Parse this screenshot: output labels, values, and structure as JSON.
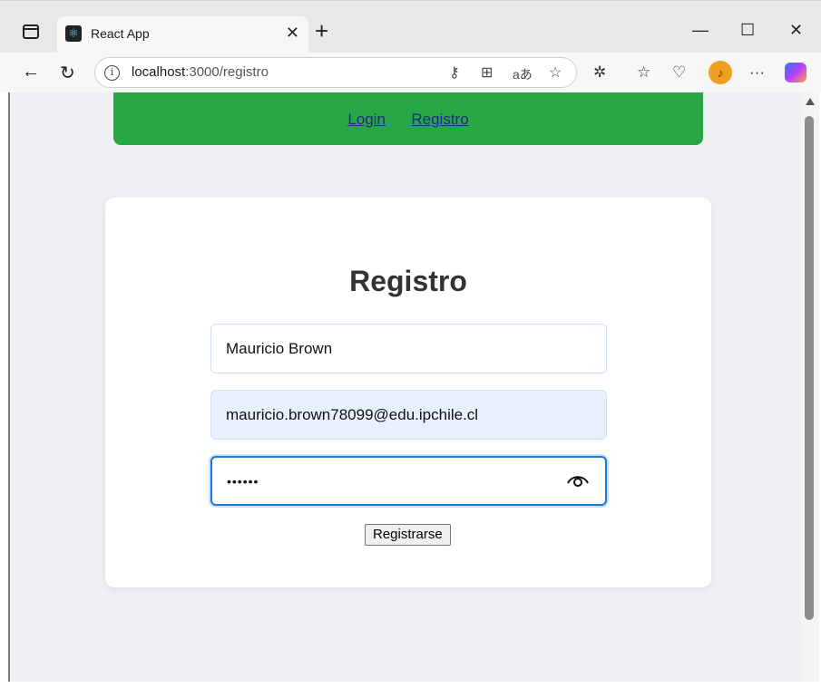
{
  "browser": {
    "tab_title": "React App",
    "url_host": "localhost",
    "url_path": ":3000/registro",
    "new_tab": "+",
    "tab_close": "✕",
    "minimize": "—",
    "maximize": "☐",
    "close": "✕",
    "more": "···"
  },
  "nav": {
    "login": "Login",
    "registro": "Registro"
  },
  "form": {
    "title": "Registro",
    "name_value": "Mauricio Brown",
    "email_value": "mauricio.brown78099@edu.ipchile.cl",
    "password_masked": "••••••",
    "submit_label": "Registrarse"
  },
  "colors": {
    "navbar": "#28a745",
    "page_bg": "#eef0f4",
    "focus": "#1e7ad6",
    "autofill": "#e8f0fe"
  }
}
